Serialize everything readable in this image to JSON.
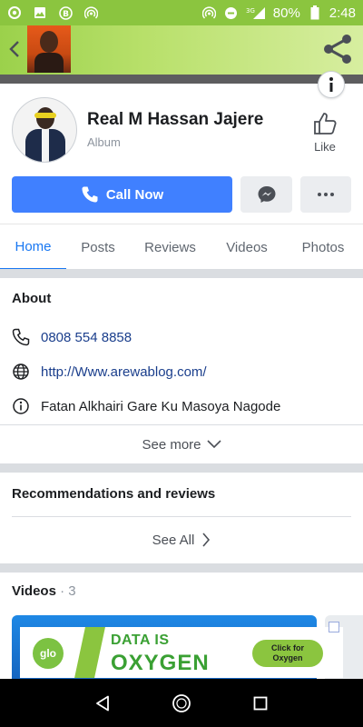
{
  "status_bar": {
    "battery_percent": "80%",
    "time": "2:48",
    "network": "3G",
    "left_icons": [
      "chrome-icon",
      "gallery-icon",
      "b-app-icon",
      "hotspot-icon"
    ],
    "right_icons": [
      "hotspot-icon",
      "dnd-icon",
      "signal-icon",
      "battery-icon"
    ],
    "bg_color": "#8bc53f"
  },
  "page": {
    "name": "Real M Hassan Jajere",
    "category": "Album",
    "like_label": "Like"
  },
  "actions": {
    "call_label": "Call Now",
    "call_color": "#4080ff"
  },
  "tabs": [
    {
      "label": "Home",
      "active": true
    },
    {
      "label": "Posts",
      "active": false
    },
    {
      "label": "Reviews",
      "active": false
    },
    {
      "label": "Videos",
      "active": false
    },
    {
      "label": "Photos",
      "active": false
    }
  ],
  "about": {
    "title": "About",
    "phone": "0808 554 8858",
    "website": "http://Www.arewablog.com/",
    "description": "Fatan Alkhairi Gare Ku Masoya Nagode",
    "see_more": "See more"
  },
  "recommendations": {
    "title": "Recommendations and reviews",
    "see_all": "See All"
  },
  "videos": {
    "title": "Videos",
    "separator": " · ",
    "count": "3"
  },
  "ad": {
    "brand": "glo",
    "line1": "DATA IS",
    "line2": "OXYGEN",
    "cta_line1": "Click for",
    "cta_line2": "Oxygen",
    "color": "#3aa033"
  },
  "accent_color": "#1877f2",
  "link_color": "#1a3e8c"
}
